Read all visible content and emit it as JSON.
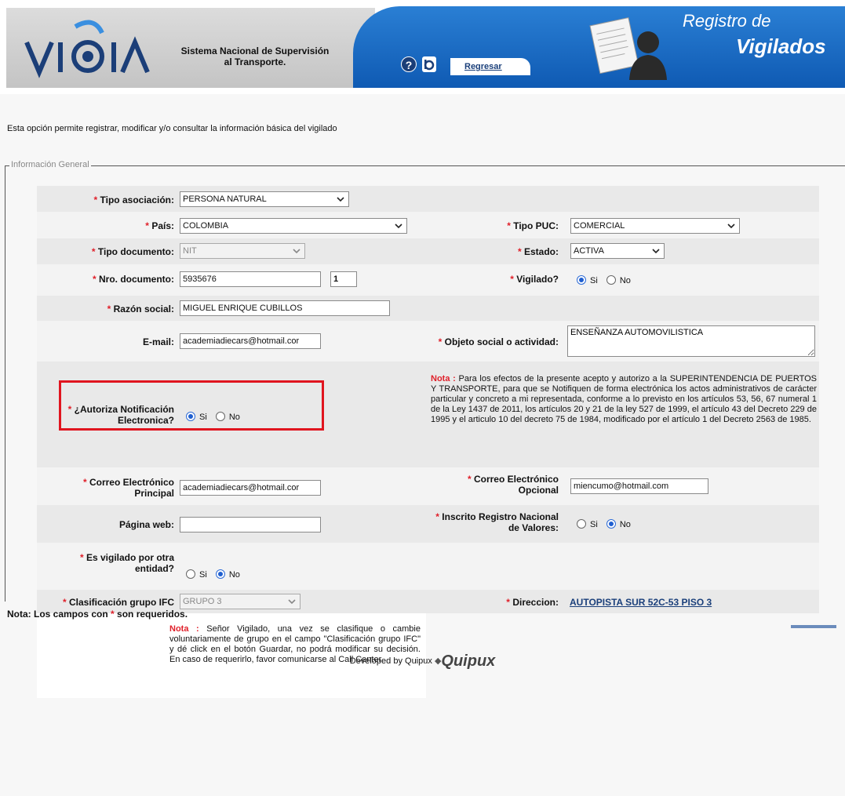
{
  "header": {
    "logo_text": "VIGIA",
    "system_name_line1": "Sistema Nacional de Supervisión",
    "system_name_line2": "al Transporte.",
    "help_icon": "help-icon",
    "back_label": "Regresar",
    "title_line1": "Registro de",
    "title_line2": "Vigilados"
  },
  "intro": "Esta opción permite registrar, modificar y/o consultar la información básica del vigilado",
  "fieldset_legend": "Información General",
  "required_mark": "*",
  "form": {
    "tipo_asociacion": {
      "label": "Tipo asociación:",
      "value": "PERSONA NATURAL"
    },
    "pais": {
      "label": "País:",
      "value": "COLOMBIA"
    },
    "tipo_puc": {
      "label": "Tipo PUC:",
      "value": "COMERCIAL"
    },
    "tipo_documento": {
      "label": "Tipo documento:",
      "value": "NIT"
    },
    "estado": {
      "label": "Estado:",
      "value": "ACTIVA"
    },
    "nro_documento": {
      "label": "Nro. documento:",
      "value": "5935676",
      "digit": "1"
    },
    "vigilado": {
      "label": "Vigilado?",
      "options": [
        "Si",
        "No"
      ],
      "selected": "Si"
    },
    "razon_social": {
      "label": "Razón social:",
      "value": "MIGUEL ENRIQUE CUBILLOS"
    },
    "email": {
      "label": "E-mail:",
      "value": "academiadiecars@hotmail.cor"
    },
    "objeto_social": {
      "label": "Objeto social o actividad:",
      "value": "ENSEÑANZA AUTOMOVILISTICA"
    },
    "autoriza": {
      "label_line1": "¿Autoriza Notificación",
      "label_line2": "Electronica?",
      "options": [
        "Si",
        "No"
      ],
      "selected": "Si"
    },
    "nota1_title": "Nota :",
    "nota1_text": "Para los efectos de la presente acepto y autorizo a la SUPERINTENDENCIA DE PUERTOS Y TRANSPORTE, para que se Notifiquen de forma electrónica los actos administrativos de carácter particular y concreto a mi representada, conforme a lo previsto en los artículos 53, 56, 67 numeral 1 de la Ley 1437 de 2011, los artículos 20 y 21 de la ley 527 de 1999, el artículo 43 del Decreto 229 de 1995 y el articulo 10 del decreto 75 de 1984, modificado por el artículo 1 del Decreto 2563 de 1985.",
    "correo_principal": {
      "label_line1": "Correo Electrónico",
      "label_line2": "Principal",
      "value": "academiadiecars@hotmail.cor"
    },
    "correo_opcional": {
      "label_line1": "Correo Electrónico",
      "label_line2": "Opcional",
      "value": "miencumo@hotmail.com"
    },
    "pagina_web": {
      "label": "Página web:",
      "value": ""
    },
    "inscrito_rnv": {
      "label_line1": "Inscrito Registro Nacional",
      "label_line2": "de Valores:",
      "options": [
        "Si",
        "No"
      ],
      "selected": "No"
    },
    "otra_entidad": {
      "label_line1": "Es vigilado por otra",
      "label_line2": "entidad?",
      "options": [
        "Si",
        "No"
      ],
      "selected": "No"
    },
    "clasificacion_ifc": {
      "label": "Clasificación grupo IFC",
      "value": "GRUPO 3"
    },
    "direccion": {
      "label": "Direccion:",
      "value": "AUTOPISTA SUR 52C-53 PISO 3"
    },
    "nota2_title": "Nota :",
    "nota2_text": "Señor Vigilado, una vez se clasifique o cambie voluntariamente de grupo en el campo \"Clasificación grupo IFC\" y dé click en el botón Guardar, no podrá modificar su decisión. En caso de requerirlo, favor comunicarse al Call Center."
  },
  "footnote_prefix": "Nota: Los campos con",
  "footnote_suffix": "son requeridos.",
  "developed_by": "Developed by Quipux",
  "quipux_logo": "Quipux",
  "colors": {
    "header_blue": "#1b6cc4",
    "required_red": "#e0202a",
    "link_blue": "#1a3f7a",
    "highlight_red": "#e0151f"
  }
}
